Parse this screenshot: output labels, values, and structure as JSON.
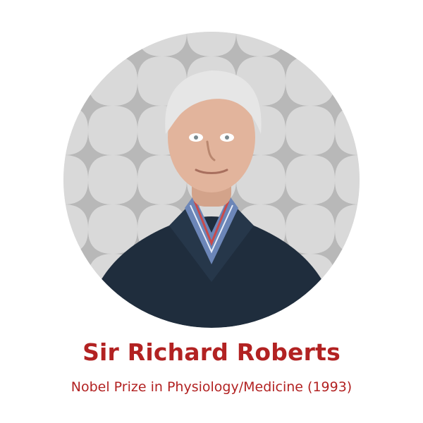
{
  "profile": {
    "name": "Sir Richard Roberts",
    "subtitle": "Nobel Prize in Physiology/Medicine (1993)"
  },
  "colors": {
    "accent": "#b22222",
    "background_pattern": "#d9d9d9",
    "pattern_shape": "#b8b8b8",
    "sweater": "#1f2d3d"
  },
  "icons": {
    "portrait": "person-portrait-icon"
  }
}
